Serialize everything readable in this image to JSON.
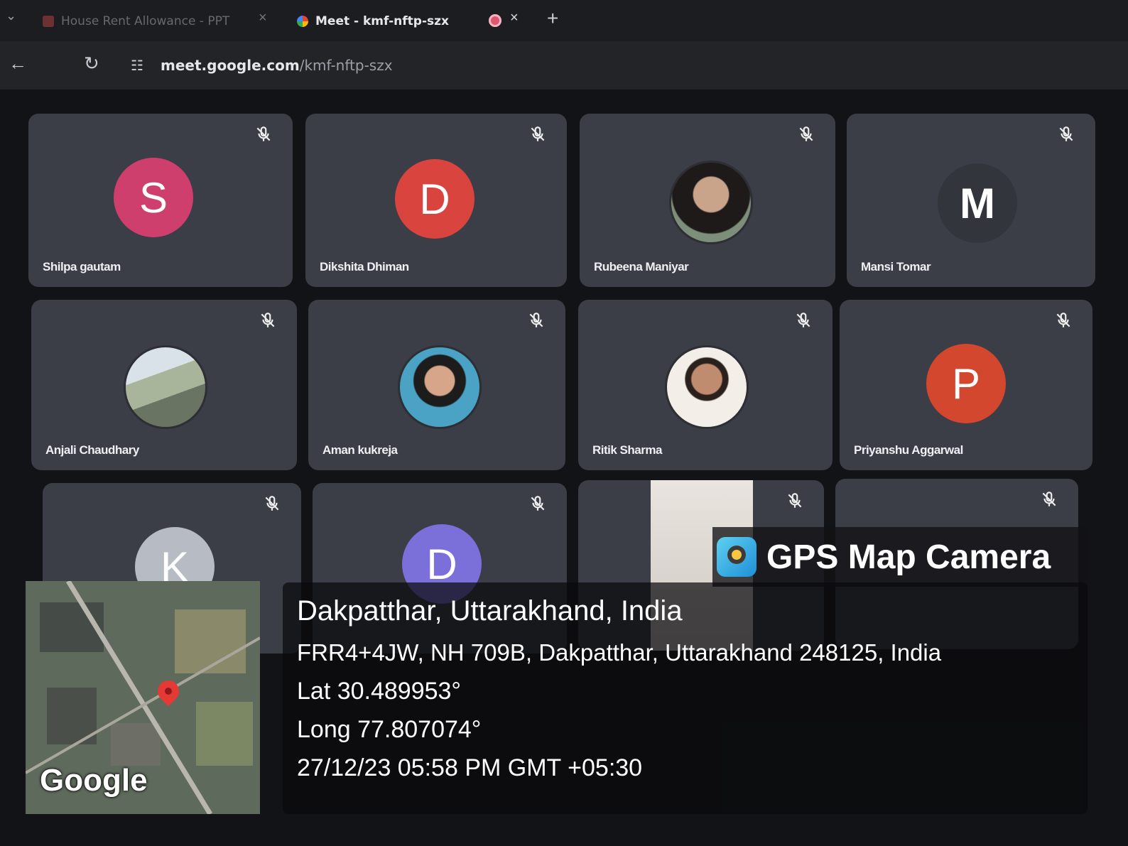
{
  "browser": {
    "tabs": [
      {
        "title": "House Rent Allowance - PPT"
      },
      {
        "title": "Meet - kmf-nftp-szx"
      }
    ],
    "close_glyph": "×",
    "new_tab_glyph": "+",
    "back_glyph": "←",
    "reload_glyph": "↻",
    "site_info_glyph": "☷",
    "url_host": "meet.google.com",
    "url_path": "/kmf-nftp-szx"
  },
  "participants": [
    {
      "name": "Shilpa gautam",
      "initial": "S",
      "color": "#cf3f6e",
      "muted": true
    },
    {
      "name": "Dikshita Dhiman",
      "initial": "D",
      "color": "#d9453e",
      "muted": true
    },
    {
      "name": "Rubeena Maniyar",
      "initial": "",
      "color": "#c9a48a",
      "muted": true,
      "photo": true
    },
    {
      "name": "Mansi Tomar",
      "initial": "M",
      "color": "#3b3d47",
      "muted": true
    },
    {
      "name": "Anjali Chaudhary",
      "initial": "",
      "color": "#9fb0a2",
      "muted": true,
      "photo": true
    },
    {
      "name": "Aman kukreja",
      "initial": "",
      "color": "#4aa3c5",
      "muted": true,
      "photo": true
    },
    {
      "name": "Ritik Sharma",
      "initial": "",
      "color": "#e7ddd3",
      "muted": true,
      "photo": true
    },
    {
      "name": "Priyanshu Aggarwal",
      "initial": "P",
      "color": "#d4472f",
      "muted": true
    },
    {
      "name": "",
      "initial": "K",
      "color": "#b7bcc4",
      "muted": true
    },
    {
      "name": "",
      "initial": "D",
      "color": "#7b6fd9",
      "muted": true
    },
    {
      "name": "",
      "initial": "",
      "color": "#3b3d47",
      "muted": true
    },
    {
      "name": "",
      "initial": "",
      "color": "#3b3d47",
      "muted": true
    }
  ],
  "gps": {
    "app_title": "GPS Map Camera",
    "place": "Dakpatthar, Uttarakhand, India",
    "address": "FRR4+4JW, NH 709B, Dakpatthar, Uttarakhand 248125, India",
    "lat": "Lat 30.489953°",
    "long": "Long 77.807074°",
    "datetime": "27/12/23 05:58 PM GMT +05:30",
    "map_label": "Google"
  }
}
